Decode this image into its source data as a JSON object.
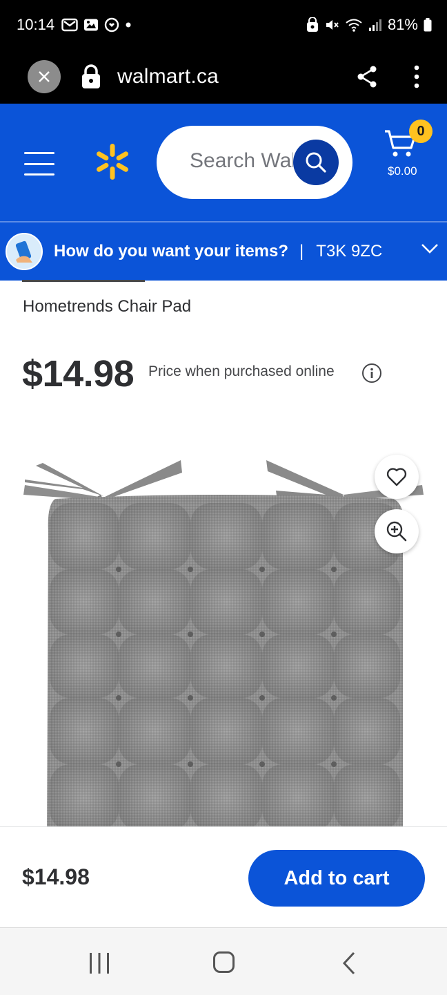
{
  "status_bar": {
    "time": "10:14",
    "battery": "81%"
  },
  "browser": {
    "url": "walmart.ca"
  },
  "header": {
    "search_placeholder": "Search Walmart",
    "cart_count": "0",
    "cart_total": "$0.00"
  },
  "delivery": {
    "prompt": "How do you want your items?",
    "separator": "|",
    "postal_code": "T3K 9ZC"
  },
  "product": {
    "title": "Hometrends Chair Pad",
    "price": "$14.98",
    "price_note": "Price when purchased online"
  },
  "sticky": {
    "price": "$14.98",
    "add_to_cart_label": "Add to cart"
  },
  "colors": {
    "brand_blue": "#0b54d8",
    "spark_yellow": "#ffc220",
    "search_button": "#0a3aa2"
  }
}
